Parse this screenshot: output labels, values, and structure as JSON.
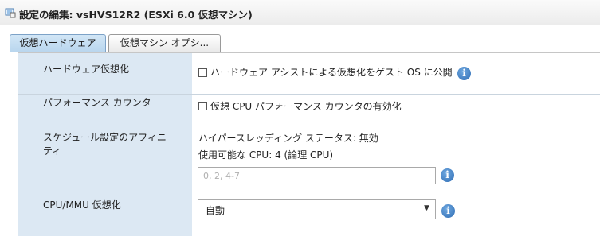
{
  "window": {
    "title": "設定の編集: vsHVS12R2 (ESXi 6.0 仮想マシン)",
    "icon": "vm-settings-icon"
  },
  "tabs": [
    {
      "label": "仮想ハードウェア",
      "active": true
    },
    {
      "label": "仮想マシン オプシ...",
      "active": false
    }
  ],
  "settings": {
    "hw_virtualization": {
      "label": "ハードウェア仮想化",
      "checkbox_label": "ハードウェア アシストによる仮想化をゲスト OS に公開",
      "checked": false
    },
    "perf_counter": {
      "label": "パフォーマンス カウンタ",
      "checkbox_label": "仮想 CPU パフォーマンス カウンタの有効化",
      "checked": false
    },
    "affinity": {
      "label": "スケジュール設定のアフィニティ",
      "hyperthreading_status": "ハイパースレッディング ステータス: 無効",
      "available_cpu": "使用可能な CPU: 4 (論理 CPU)",
      "input_value": "",
      "input_placeholder": "0, 2, 4-7"
    },
    "cpu_mmu": {
      "label": "CPU/MMU 仮想化",
      "selected": "自動"
    }
  },
  "info_glyph": "i",
  "colors": {
    "label_column_bg": "#dce8f3",
    "active_tab_bg": "#c5def2",
    "info_icon": "#3a7bc8"
  }
}
